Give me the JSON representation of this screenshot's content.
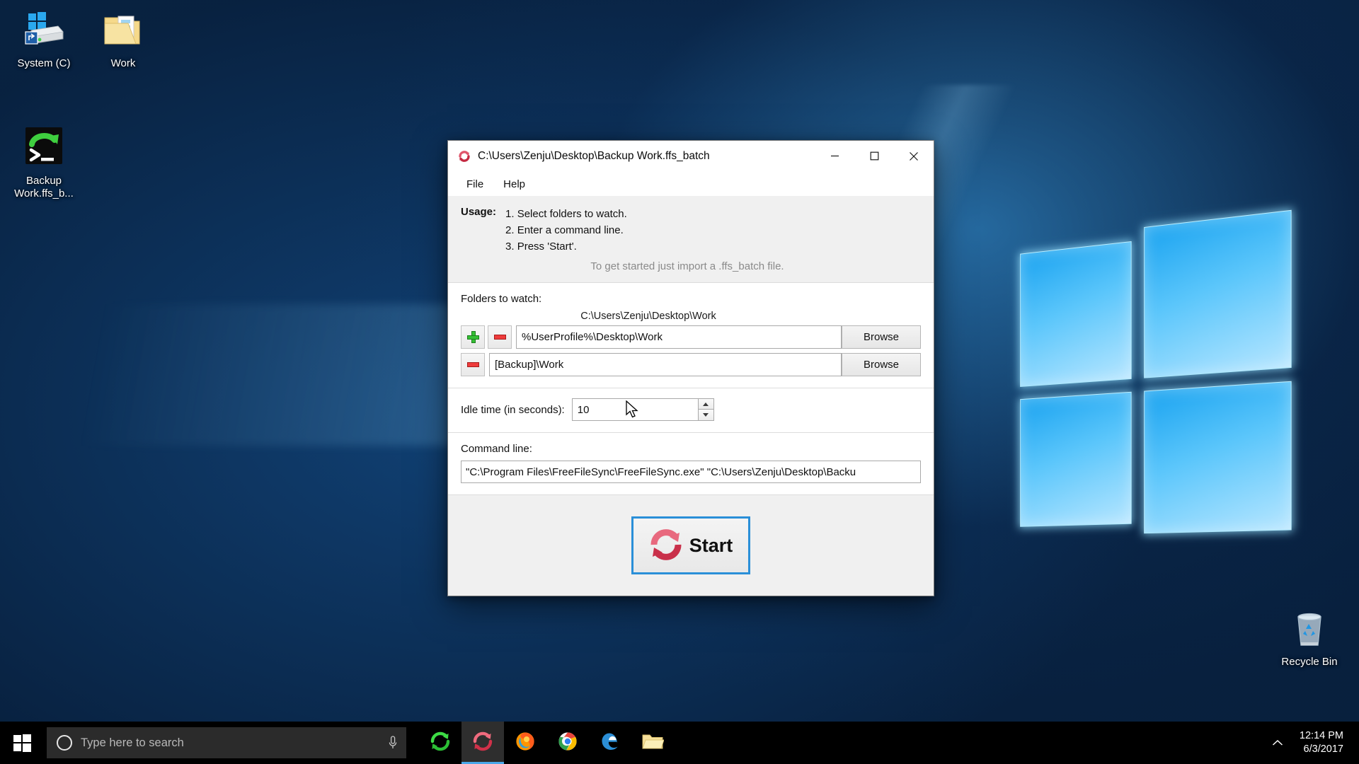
{
  "desktop": {
    "icons": [
      {
        "name": "system-drive",
        "label": "System (C)",
        "icon": "hard-drive-shortcut-icon"
      },
      {
        "name": "work-folder",
        "label": "Work",
        "icon": "folder-icon"
      },
      {
        "name": "backup-batch-file",
        "label": "Backup Work.ffs_b...",
        "icon": "ffs-batch-icon"
      },
      {
        "name": "recycle-bin",
        "label": "Recycle Bin",
        "icon": "recycle-bin-icon"
      }
    ]
  },
  "window": {
    "title": "C:\\Users\\Zenju\\Desktop\\Backup Work.ffs_batch",
    "title_icon": "realtimesync-icon",
    "controls": {
      "minimize": "minimize-button",
      "maximize": "maximize-button",
      "close": "close-button"
    },
    "menu": [
      {
        "label": "File"
      },
      {
        "label": "Help"
      }
    ],
    "usage": {
      "label": "Usage:",
      "steps": [
        "1. Select folders to watch.",
        "2. Enter a command line.",
        "3. Press 'Start'."
      ],
      "hint": "To get started just import a .ffs_batch file."
    },
    "folders": {
      "section_label": "Folders to watch:",
      "resolved_path": "C:\\Users\\Zenju\\Desktop\\Work",
      "rows": [
        {
          "add_button": "+",
          "remove_button": "–",
          "value": "%UserProfile%\\Desktop\\Work",
          "browse_label": "Browse"
        },
        {
          "remove_button": "–",
          "value": "[Backup]\\Work",
          "browse_label": "Browse"
        }
      ]
    },
    "idle": {
      "label": "Idle time (in seconds):",
      "value": "10"
    },
    "command": {
      "label": "Command line:",
      "value": "\"C:\\Program Files\\FreeFileSync\\FreeFileSync.exe\" \"C:\\Users\\Zenju\\Desktop\\Backu"
    },
    "start": {
      "label": "Start",
      "icon": "sync-arrows-icon"
    }
  },
  "taskbar": {
    "start_button": "start-button",
    "search": {
      "placeholder": "Type here to search",
      "cortana_icon": "cortana-circle-icon",
      "mic_icon": "microphone-icon"
    },
    "apps": [
      {
        "name": "freefilesync",
        "icon": "green-sync-icon",
        "active": false
      },
      {
        "name": "realtimesync",
        "icon": "red-sync-icon",
        "active": true
      },
      {
        "name": "firefox",
        "icon": "firefox-icon",
        "active": false
      },
      {
        "name": "chrome",
        "icon": "chrome-icon",
        "active": false
      },
      {
        "name": "edge",
        "icon": "edge-icon",
        "active": false
      },
      {
        "name": "file-explorer",
        "icon": "folder-icon",
        "active": false
      }
    ],
    "tray": {
      "chevron_icon": "chevron-up-icon",
      "time": "12:14 PM",
      "date": "6/3/2017"
    }
  },
  "colors": {
    "accent": "#0078d7",
    "taskbar": "#000000",
    "window_bg": "#f0f0f0",
    "add_green": "#35c035",
    "remove_red": "#ee3b3b",
    "focus_blue": "#2a8fd8"
  }
}
